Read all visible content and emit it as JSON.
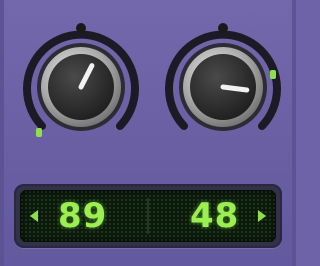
{
  "knobs": [
    {
      "id": "left",
      "level": 0.6,
      "accent": "#8de04a"
    },
    {
      "id": "right",
      "level": 0.86,
      "accent": "#8de04a"
    }
  ],
  "display": {
    "left_value": "89",
    "right_value": "48",
    "lcd_color": "#9bf04f",
    "left_arrow_icon": "triangle-left-icon",
    "right_arrow_icon": "triangle-right-icon"
  },
  "colors": {
    "panel": "#6e62a8",
    "knob_body": "#2b2b2b",
    "knob_rim": "#bdbdbd",
    "indicator": "#8de04a"
  }
}
